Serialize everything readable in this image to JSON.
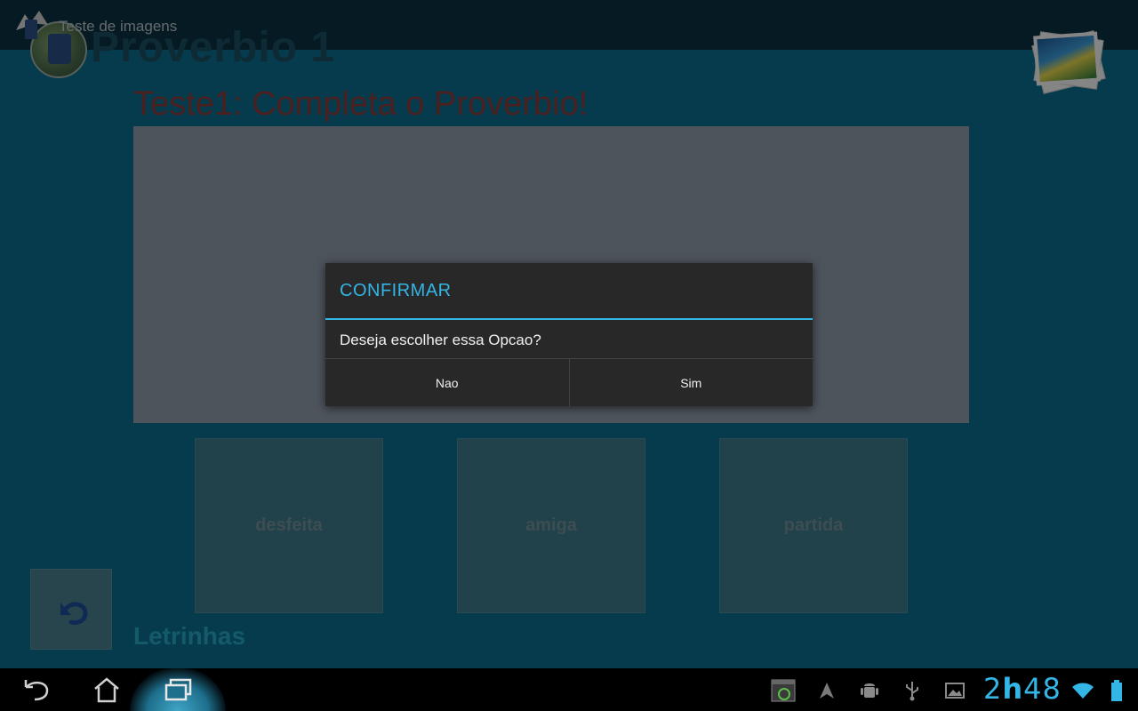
{
  "app": {
    "actionbar_title": "Teste de imagens",
    "proverb_title": "Proverbio 1",
    "test_title": "Teste1: Completa o Proverbio!",
    "options": [
      "desfeita",
      "amiga",
      "partida"
    ],
    "section_label": "Letrinhas"
  },
  "dialog": {
    "title": "CONFIRMAR",
    "message": "Deseja escolher essa Opcao?",
    "buttons": {
      "negative": "Nao",
      "positive": "Sim"
    }
  },
  "system": {
    "clock_hours": "2",
    "clock_separator": "h",
    "clock_minutes": "48",
    "icons": [
      "back-icon",
      "home-icon",
      "recents-icon",
      "screenshot-icon",
      "navigation-icon",
      "android-debug-icon",
      "usb-icon",
      "gallery-icon",
      "wifi-icon",
      "battery-icon"
    ]
  },
  "colors": {
    "accent": "#33b5e5",
    "dialog_bg": "#282828",
    "app_bg": "#0b6c8c"
  }
}
